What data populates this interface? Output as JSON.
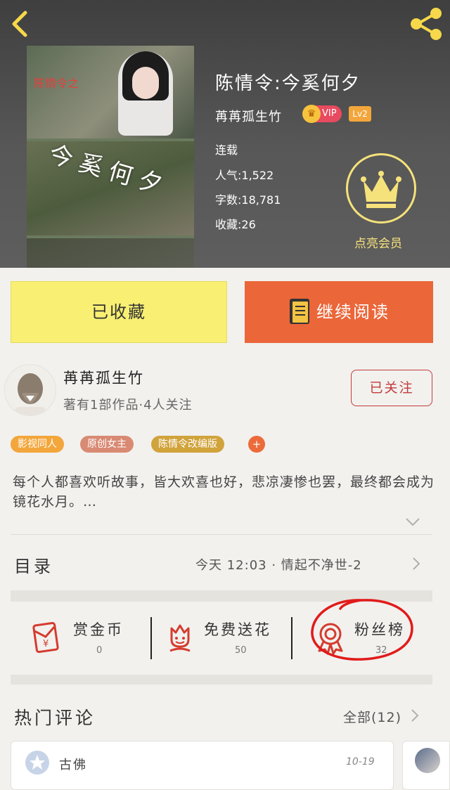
{
  "header": {
    "cover_text_vertical": "今奚何夕",
    "cover_text_red": "陈情令之",
    "book_title": "陈情令:今奚何夕",
    "author": "苒苒孤生竹",
    "vip_badge": "VIP",
    "level_badge": "Lv2",
    "status": "连载",
    "popularity": "人气:1,522",
    "word_count": "字数:18,781",
    "favorites": "收藏:26",
    "member_label": "点亮会员"
  },
  "actions": {
    "favorited_label": "已收藏",
    "continue_label": "继续阅读"
  },
  "author_info": {
    "name": "苒苒孤生竹",
    "subtitle": "著有1部作品·4人关注",
    "follow_label": "已关注"
  },
  "tags": [
    {
      "label": "影视同人",
      "color": "#f3a63b"
    },
    {
      "label": "原创女主",
      "color": "#d98a73"
    },
    {
      "label": "陈情令改编版",
      "color": "#d1a33b"
    }
  ],
  "tag_add": "+",
  "synopsis": "每个人都喜欢听故事，皆大欢喜也好，悲凉凄惨也罢，最终都会成为镜花水月。…",
  "toc": {
    "label": "目录",
    "latest": "今天 12:03 · 情起不净世-2"
  },
  "stats": [
    {
      "label": "赏金币",
      "value": "0",
      "icon": "red-envelope-icon"
    },
    {
      "label": "免费送花",
      "value": "50",
      "icon": "flower-icon"
    },
    {
      "label": "粉丝榜",
      "value": "32",
      "icon": "medal-icon"
    }
  ],
  "comments": {
    "label": "热门评论",
    "all_label": "全部(12)",
    "first": {
      "user": "古佛",
      "date": "10-19"
    }
  },
  "colors": {
    "accent_orange": "#eb6639",
    "favorite_yellow": "#f9ef72",
    "red": "#c23b3b",
    "gold": "#f6e27b"
  }
}
